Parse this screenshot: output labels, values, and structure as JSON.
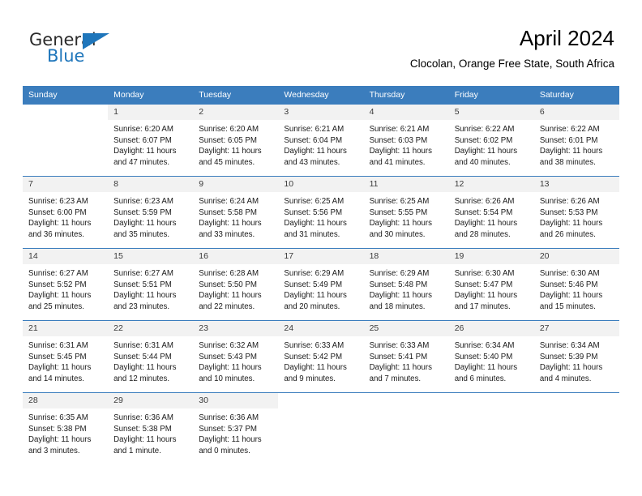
{
  "logo": {
    "word_one": "General",
    "word_two": "Blue",
    "triangle_color": "#1f76bb",
    "text_color": "#2b2b2b"
  },
  "header": {
    "title": "April 2024",
    "subtitle": "Clocolan, Orange Free State, South Africa"
  },
  "theme": {
    "header_bg": "#3b7dbd",
    "header_text": "#ffffff",
    "daynum_bg": "#f2f2f2",
    "row_border": "#3b7dbd",
    "body_text": "#1a1a1a"
  },
  "calendar": {
    "columns": [
      "Sunday",
      "Monday",
      "Tuesday",
      "Wednesday",
      "Thursday",
      "Friday",
      "Saturday"
    ],
    "weeks": [
      [
        {
          "day": "",
          "sunrise": "",
          "sunset": "",
          "daylight_line1": "",
          "daylight_line2": "",
          "empty": true
        },
        {
          "day": "1",
          "sunrise": "Sunrise: 6:20 AM",
          "sunset": "Sunset: 6:07 PM",
          "daylight_line1": "Daylight: 11 hours",
          "daylight_line2": "and 47 minutes.",
          "empty": false
        },
        {
          "day": "2",
          "sunrise": "Sunrise: 6:20 AM",
          "sunset": "Sunset: 6:05 PM",
          "daylight_line1": "Daylight: 11 hours",
          "daylight_line2": "and 45 minutes.",
          "empty": false
        },
        {
          "day": "3",
          "sunrise": "Sunrise: 6:21 AM",
          "sunset": "Sunset: 6:04 PM",
          "daylight_line1": "Daylight: 11 hours",
          "daylight_line2": "and 43 minutes.",
          "empty": false
        },
        {
          "day": "4",
          "sunrise": "Sunrise: 6:21 AM",
          "sunset": "Sunset: 6:03 PM",
          "daylight_line1": "Daylight: 11 hours",
          "daylight_line2": "and 41 minutes.",
          "empty": false
        },
        {
          "day": "5",
          "sunrise": "Sunrise: 6:22 AM",
          "sunset": "Sunset: 6:02 PM",
          "daylight_line1": "Daylight: 11 hours",
          "daylight_line2": "and 40 minutes.",
          "empty": false
        },
        {
          "day": "6",
          "sunrise": "Sunrise: 6:22 AM",
          "sunset": "Sunset: 6:01 PM",
          "daylight_line1": "Daylight: 11 hours",
          "daylight_line2": "and 38 minutes.",
          "empty": false
        }
      ],
      [
        {
          "day": "7",
          "sunrise": "Sunrise: 6:23 AM",
          "sunset": "Sunset: 6:00 PM",
          "daylight_line1": "Daylight: 11 hours",
          "daylight_line2": "and 36 minutes.",
          "empty": false
        },
        {
          "day": "8",
          "sunrise": "Sunrise: 6:23 AM",
          "sunset": "Sunset: 5:59 PM",
          "daylight_line1": "Daylight: 11 hours",
          "daylight_line2": "and 35 minutes.",
          "empty": false
        },
        {
          "day": "9",
          "sunrise": "Sunrise: 6:24 AM",
          "sunset": "Sunset: 5:58 PM",
          "daylight_line1": "Daylight: 11 hours",
          "daylight_line2": "and 33 minutes.",
          "empty": false
        },
        {
          "day": "10",
          "sunrise": "Sunrise: 6:25 AM",
          "sunset": "Sunset: 5:56 PM",
          "daylight_line1": "Daylight: 11 hours",
          "daylight_line2": "and 31 minutes.",
          "empty": false
        },
        {
          "day": "11",
          "sunrise": "Sunrise: 6:25 AM",
          "sunset": "Sunset: 5:55 PM",
          "daylight_line1": "Daylight: 11 hours",
          "daylight_line2": "and 30 minutes.",
          "empty": false
        },
        {
          "day": "12",
          "sunrise": "Sunrise: 6:26 AM",
          "sunset": "Sunset: 5:54 PM",
          "daylight_line1": "Daylight: 11 hours",
          "daylight_line2": "and 28 minutes.",
          "empty": false
        },
        {
          "day": "13",
          "sunrise": "Sunrise: 6:26 AM",
          "sunset": "Sunset: 5:53 PM",
          "daylight_line1": "Daylight: 11 hours",
          "daylight_line2": "and 26 minutes.",
          "empty": false
        }
      ],
      [
        {
          "day": "14",
          "sunrise": "Sunrise: 6:27 AM",
          "sunset": "Sunset: 5:52 PM",
          "daylight_line1": "Daylight: 11 hours",
          "daylight_line2": "and 25 minutes.",
          "empty": false
        },
        {
          "day": "15",
          "sunrise": "Sunrise: 6:27 AM",
          "sunset": "Sunset: 5:51 PM",
          "daylight_line1": "Daylight: 11 hours",
          "daylight_line2": "and 23 minutes.",
          "empty": false
        },
        {
          "day": "16",
          "sunrise": "Sunrise: 6:28 AM",
          "sunset": "Sunset: 5:50 PM",
          "daylight_line1": "Daylight: 11 hours",
          "daylight_line2": "and 22 minutes.",
          "empty": false
        },
        {
          "day": "17",
          "sunrise": "Sunrise: 6:29 AM",
          "sunset": "Sunset: 5:49 PM",
          "daylight_line1": "Daylight: 11 hours",
          "daylight_line2": "and 20 minutes.",
          "empty": false
        },
        {
          "day": "18",
          "sunrise": "Sunrise: 6:29 AM",
          "sunset": "Sunset: 5:48 PM",
          "daylight_line1": "Daylight: 11 hours",
          "daylight_line2": "and 18 minutes.",
          "empty": false
        },
        {
          "day": "19",
          "sunrise": "Sunrise: 6:30 AM",
          "sunset": "Sunset: 5:47 PM",
          "daylight_line1": "Daylight: 11 hours",
          "daylight_line2": "and 17 minutes.",
          "empty": false
        },
        {
          "day": "20",
          "sunrise": "Sunrise: 6:30 AM",
          "sunset": "Sunset: 5:46 PM",
          "daylight_line1": "Daylight: 11 hours",
          "daylight_line2": "and 15 minutes.",
          "empty": false
        }
      ],
      [
        {
          "day": "21",
          "sunrise": "Sunrise: 6:31 AM",
          "sunset": "Sunset: 5:45 PM",
          "daylight_line1": "Daylight: 11 hours",
          "daylight_line2": "and 14 minutes.",
          "empty": false
        },
        {
          "day": "22",
          "sunrise": "Sunrise: 6:31 AM",
          "sunset": "Sunset: 5:44 PM",
          "daylight_line1": "Daylight: 11 hours",
          "daylight_line2": "and 12 minutes.",
          "empty": false
        },
        {
          "day": "23",
          "sunrise": "Sunrise: 6:32 AM",
          "sunset": "Sunset: 5:43 PM",
          "daylight_line1": "Daylight: 11 hours",
          "daylight_line2": "and 10 minutes.",
          "empty": false
        },
        {
          "day": "24",
          "sunrise": "Sunrise: 6:33 AM",
          "sunset": "Sunset: 5:42 PM",
          "daylight_line1": "Daylight: 11 hours",
          "daylight_line2": "and 9 minutes.",
          "empty": false
        },
        {
          "day": "25",
          "sunrise": "Sunrise: 6:33 AM",
          "sunset": "Sunset: 5:41 PM",
          "daylight_line1": "Daylight: 11 hours",
          "daylight_line2": "and 7 minutes.",
          "empty": false
        },
        {
          "day": "26",
          "sunrise": "Sunrise: 6:34 AM",
          "sunset": "Sunset: 5:40 PM",
          "daylight_line1": "Daylight: 11 hours",
          "daylight_line2": "and 6 minutes.",
          "empty": false
        },
        {
          "day": "27",
          "sunrise": "Sunrise: 6:34 AM",
          "sunset": "Sunset: 5:39 PM",
          "daylight_line1": "Daylight: 11 hours",
          "daylight_line2": "and 4 minutes.",
          "empty": false
        }
      ],
      [
        {
          "day": "28",
          "sunrise": "Sunrise: 6:35 AM",
          "sunset": "Sunset: 5:38 PM",
          "daylight_line1": "Daylight: 11 hours",
          "daylight_line2": "and 3 minutes.",
          "empty": false
        },
        {
          "day": "29",
          "sunrise": "Sunrise: 6:36 AM",
          "sunset": "Sunset: 5:38 PM",
          "daylight_line1": "Daylight: 11 hours",
          "daylight_line2": "and 1 minute.",
          "empty": false
        },
        {
          "day": "30",
          "sunrise": "Sunrise: 6:36 AM",
          "sunset": "Sunset: 5:37 PM",
          "daylight_line1": "Daylight: 11 hours",
          "daylight_line2": "and 0 minutes.",
          "empty": false
        },
        {
          "day": "",
          "sunrise": "",
          "sunset": "",
          "daylight_line1": "",
          "daylight_line2": "",
          "empty": true
        },
        {
          "day": "",
          "sunrise": "",
          "sunset": "",
          "daylight_line1": "",
          "daylight_line2": "",
          "empty": true
        },
        {
          "day": "",
          "sunrise": "",
          "sunset": "",
          "daylight_line1": "",
          "daylight_line2": "",
          "empty": true
        },
        {
          "day": "",
          "sunrise": "",
          "sunset": "",
          "daylight_line1": "",
          "daylight_line2": "",
          "empty": true
        }
      ]
    ]
  }
}
